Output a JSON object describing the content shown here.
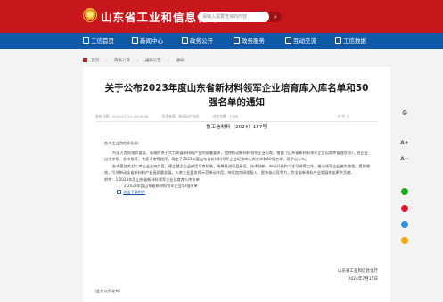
{
  "header": {
    "site_title": "山东省工业和信息化厅",
    "search_placeholder": "请输入需要查询的内容",
    "search_button": "⌕"
  },
  "nav": {
    "items": [
      {
        "label": "工信首页"
      },
      {
        "label": "新闻中心"
      },
      {
        "label": "政务公开"
      },
      {
        "label": "政务服务"
      },
      {
        "label": "互动交流"
      },
      {
        "label": "工信数据"
      }
    ]
  },
  "breadcrumb": [
    "首页",
    "政务公开",
    "通知公告",
    "通知"
  ],
  "article": {
    "title": "关于公布2023年度山东省新材料领军企业培育库入库名单和50强名单的通知",
    "meta": {
      "date": "发布日期：2024-07-23 15:00:08",
      "source": "信息来源：新材料产业处",
      "views": "浏览次数：1396",
      "zoom": "大 中 小"
    },
    "doc_number": "鲁工信材料〔2024〕157号",
    "salutation": "各市工业和信息化局：",
    "paragraphs": [
      "为深入贯彻落实省委、省政府关于大力发展新材料产业的部署要求，加快推动新材料领军企业培育，根据《山东省新材料领军企业培育库管理办法》，经企业自主申报、各市推荐、专家评审等程序，确定了2023年度山东省新材料领军企业培育库入库名单和50强名单，现予以公布。",
      "各市要加大对入库企业支持力度，建立健全企业梯度培育机制，统筹推进项目建设、技术创新、市场开拓和人才引进等工作，推动领军企业做大做强、提质增效，引领带动全省新材料产业高质量发展。入库企业要发挥示范带动作用，持续加大研发投入，提升核心竞争力，为全省新材料产业发展作出更大贡献。"
    ],
    "attachments": {
      "label": "附件：",
      "items": [
        "1.2023年度山东省新材料领军企业培育库入库名单",
        "2.2023年度山东省新材料领军企业50强名单"
      ],
      "download_link": "点击下载附件"
    },
    "signature_org": "山东省工业和信息化厅",
    "signature_date": "2024年7月15日",
    "public_note": "（此件公开发布）"
  },
  "rail": {
    "items": [
      "⎙",
      "A+",
      "A−"
    ],
    "share_colors": [
      "#1aad19",
      "#e6162d",
      "#2e8ee0",
      "#f7a600"
    ]
  }
}
